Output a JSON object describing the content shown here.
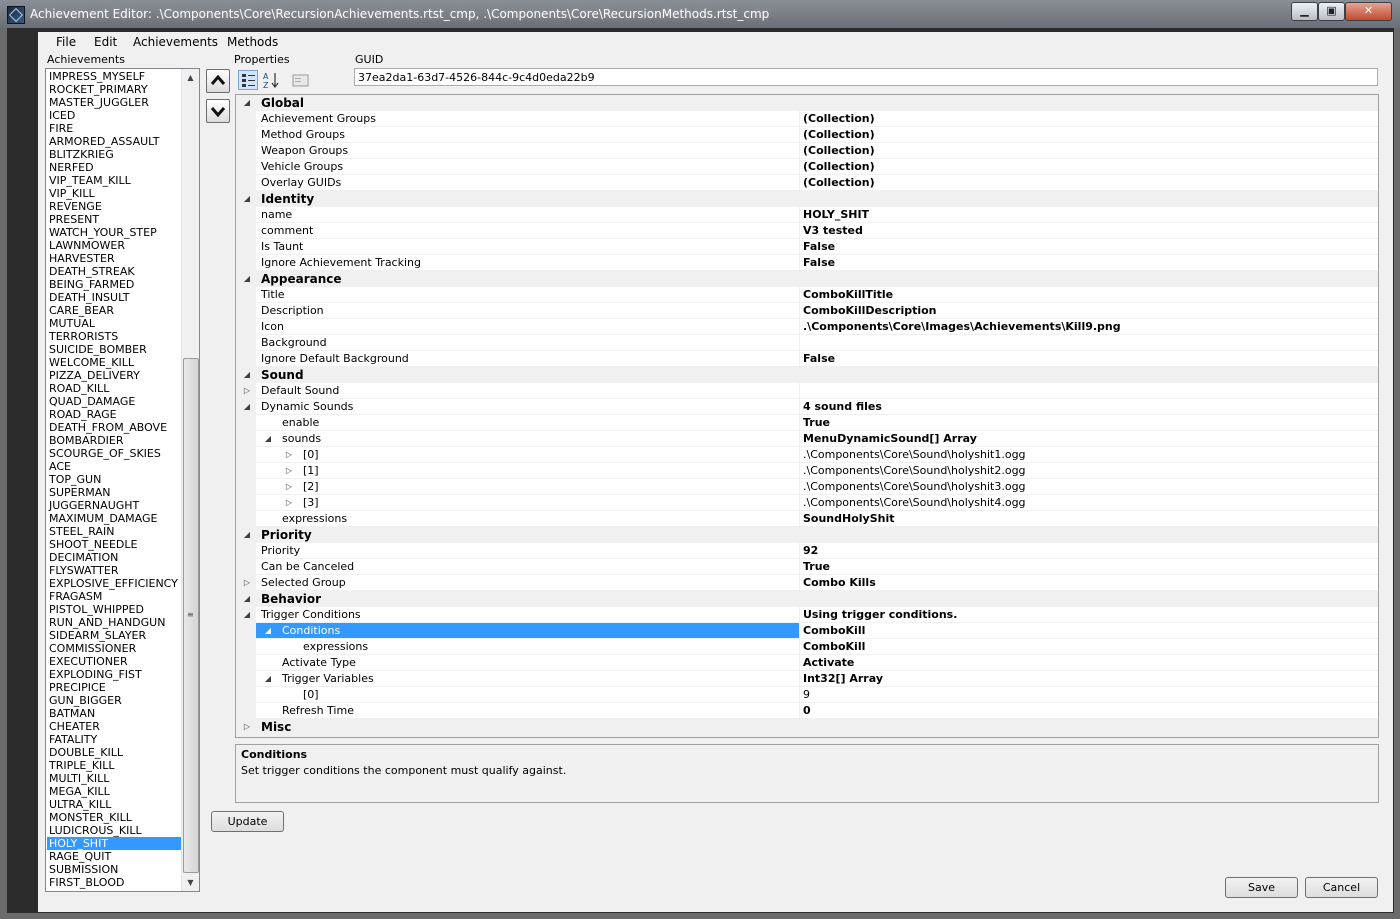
{
  "window": {
    "title": "Achievement Editor: .\\Components\\Core\\RecursionAchievements.rtst_cmp, .\\Components\\Core\\RecursionMethods.rtst_cmp",
    "minimize_glyph": "▁",
    "maximize_glyph": "▣",
    "close_glyph": "✕"
  },
  "menu": [
    "File",
    "Edit",
    "Achievements",
    "Methods"
  ],
  "labels": {
    "achievements": "Achievements",
    "properties": "Properties",
    "guid": "GUID"
  },
  "guid_value": "37ea2da1-63d7-4526-844c-9c4d0eda22b9",
  "achievements": {
    "items": [
      "IMPRESS_MYSELF",
      "ROCKET_PRIMARY",
      "MASTER_JUGGLER",
      "ICED",
      "FIRE",
      "ARMORED_ASSAULT",
      "BLITZKRIEG",
      "NERFED",
      "VIP_TEAM_KILL",
      "VIP_KILL",
      "REVENGE",
      "PRESENT",
      "WATCH_YOUR_STEP",
      "LAWNMOWER",
      "HARVESTER",
      "DEATH_STREAK",
      "BEING_FARMED",
      "DEATH_INSULT",
      "CARE_BEAR",
      "MUTUAL",
      "TERRORISTS",
      "SUICIDE_BOMBER",
      "WELCOME_KILL",
      "PIZZA_DELIVERY",
      "ROAD_KILL",
      "QUAD_DAMAGE",
      "ROAD_RAGE",
      "DEATH_FROM_ABOVE",
      "BOMBARDIER",
      "SCOURGE_OF_SKIES",
      "ACE",
      "TOP_GUN",
      "SUPERMAN",
      "JUGGERNAUGHT",
      "MAXIMUM_DAMAGE",
      "STEEL_RAIN",
      "SHOOT_NEEDLE",
      "DECIMATION",
      "FLYSWATTER",
      "EXPLOSIVE_EFFICIENCY",
      "FRAGASM",
      "PISTOL_WHIPPED",
      "RUN_AND_HANDGUN",
      "SIDEARM_SLAYER",
      "COMMISSIONER",
      "EXECUTIONER",
      "EXPLODING_FIST",
      "PRECIPICE",
      "GUN_BIGGER",
      "BATMAN",
      "CHEATER",
      "FATALITY",
      "DOUBLE_KILL",
      "TRIPLE_KILL",
      "MULTI_KILL",
      "MEGA_KILL",
      "ULTRA_KILL",
      "MONSTER_KILL",
      "LUDICROUS_KILL",
      "HOLY_SHIT",
      "RAGE_QUIT",
      "SUBMISSION",
      "FIRST_BLOOD"
    ],
    "selected": "HOLY_SHIT"
  },
  "grid": {
    "rows": [
      {
        "type": "cat",
        "name": "Global",
        "exp": "down"
      },
      {
        "name": "Achievement Groups",
        "value": "(Collection)",
        "bold": true,
        "indent": 0
      },
      {
        "name": "Method Groups",
        "value": "(Collection)",
        "bold": true,
        "indent": 0
      },
      {
        "name": "Weapon Groups",
        "value": "(Collection)",
        "bold": true,
        "indent": 0
      },
      {
        "name": "Vehicle Groups",
        "value": "(Collection)",
        "bold": true,
        "indent": 0
      },
      {
        "name": "Overlay GUIDs",
        "value": "(Collection)",
        "bold": true,
        "indent": 0
      },
      {
        "type": "cat",
        "name": "Identity",
        "exp": "down"
      },
      {
        "name": "name",
        "value": "HOLY_SHIT",
        "bold": true,
        "indent": 0
      },
      {
        "name": "comment",
        "value": "V3 tested",
        "bold": true,
        "indent": 0
      },
      {
        "name": "Is Taunt",
        "value": "False",
        "bold": true,
        "indent": 0
      },
      {
        "name": "Ignore Achievement Tracking",
        "value": "False",
        "bold": true,
        "indent": 0
      },
      {
        "type": "cat",
        "name": "Appearance",
        "exp": "down"
      },
      {
        "name": "Title",
        "value": "ComboKillTitle",
        "bold": true,
        "indent": 0
      },
      {
        "name": "Description",
        "value": "ComboKillDescription",
        "bold": true,
        "indent": 0
      },
      {
        "name": "Icon",
        "value": ".\\Components\\Core\\Images\\Achievements\\Kill9.png",
        "bold": true,
        "indent": 0
      },
      {
        "name": "Background",
        "value": "",
        "bold": false,
        "indent": 0
      },
      {
        "name": "Ignore Default Background",
        "value": "False",
        "bold": true,
        "indent": 0
      },
      {
        "type": "cat",
        "name": "Sound",
        "exp": "down"
      },
      {
        "name": "Default Sound",
        "value": "",
        "bold": false,
        "indent": 0,
        "exp": "right"
      },
      {
        "name": "Dynamic Sounds",
        "value": "4 sound files",
        "bold": true,
        "indent": 0,
        "exp": "down"
      },
      {
        "name": "enable",
        "value": "True",
        "bold": true,
        "indent": 1
      },
      {
        "name": "sounds",
        "value": "MenuDynamicSound[] Array",
        "bold": true,
        "indent": 1,
        "exp": "down"
      },
      {
        "name": "[0]",
        "value": ".\\Components\\Core\\Sound\\holyshit1.ogg",
        "bold": false,
        "indent": 2,
        "exp": "right"
      },
      {
        "name": "[1]",
        "value": ".\\Components\\Core\\Sound\\holyshit2.ogg",
        "bold": false,
        "indent": 2,
        "exp": "right"
      },
      {
        "name": "[2]",
        "value": ".\\Components\\Core\\Sound\\holyshit3.ogg",
        "bold": false,
        "indent": 2,
        "exp": "right"
      },
      {
        "name": "[3]",
        "value": ".\\Components\\Core\\Sound\\holyshit4.ogg",
        "bold": false,
        "indent": 2,
        "exp": "right"
      },
      {
        "name": "expressions",
        "value": "SoundHolyShit",
        "bold": true,
        "indent": 1
      },
      {
        "type": "cat",
        "name": "Priority",
        "exp": "down"
      },
      {
        "name": "Priority",
        "value": "92",
        "bold": true,
        "indent": 0
      },
      {
        "name": "Can be Canceled",
        "value": "True",
        "bold": true,
        "indent": 0
      },
      {
        "name": "Selected Group",
        "value": "Combo Kills",
        "bold": true,
        "indent": 0,
        "exp": "right"
      },
      {
        "type": "cat",
        "name": "Behavior",
        "exp": "down"
      },
      {
        "name": "Trigger Conditions",
        "value": "Using trigger conditions.",
        "bold": true,
        "indent": 0,
        "exp": "down"
      },
      {
        "name": "Conditions",
        "value": "ComboKill",
        "bold": true,
        "indent": 1,
        "exp": "down",
        "selected": true
      },
      {
        "name": "expressions",
        "value": "ComboKill",
        "bold": true,
        "indent": 2
      },
      {
        "name": "Activate Type",
        "value": "Activate",
        "bold": true,
        "indent": 1
      },
      {
        "name": "Trigger Variables",
        "value": "Int32[] Array",
        "bold": true,
        "indent": 1,
        "exp": "down"
      },
      {
        "name": "[0]",
        "value": "9",
        "bold": false,
        "indent": 2
      },
      {
        "name": "Refresh Time",
        "value": "0",
        "bold": true,
        "indent": 1
      },
      {
        "type": "cat",
        "name": "Misc",
        "exp": "right"
      }
    ]
  },
  "description": {
    "title": "Conditions",
    "text": "Set trigger conditions the component must qualify against."
  },
  "buttons": {
    "update": "Update",
    "save": "Save",
    "cancel": "Cancel"
  },
  "colors": {
    "selection": "#3399ff",
    "title_bar": "#7a7f87"
  }
}
